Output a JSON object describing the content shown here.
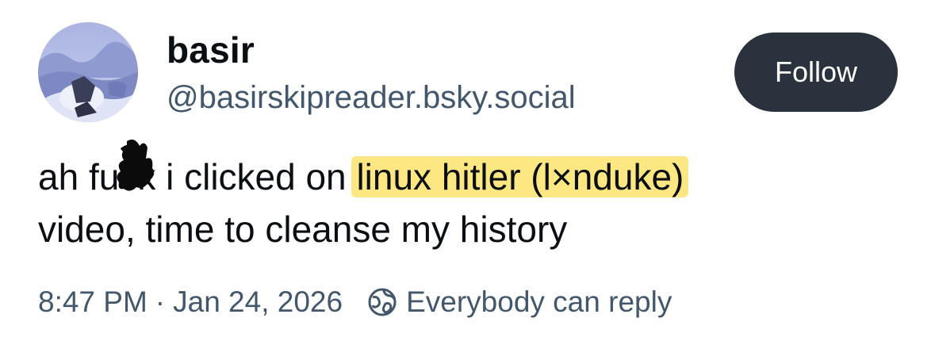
{
  "author": {
    "display_name": "basir",
    "handle": "@basirskipreader.bsky.social",
    "avatar_icon": "avatar-image"
  },
  "actions": {
    "follow_label": "Follow"
  },
  "post": {
    "line1_before": "ah fu",
    "line1_censored": "ck",
    "line1_middle": " i clicked on ",
    "line1_highlight": "linux hitler (l×nduke)",
    "line2": "video, time to cleanse my history",
    "highlight_color": "#fce782"
  },
  "meta": {
    "time": "8:47 PM",
    "separator": "·",
    "date": "Jan 24, 2026",
    "reply_icon": "reply-permissions-icon",
    "reply_setting": "Everybody can reply"
  },
  "colors": {
    "follow_button_bg": "#2a323d",
    "secondary_text": "#42576c",
    "primary_text": "#0b0f14"
  }
}
